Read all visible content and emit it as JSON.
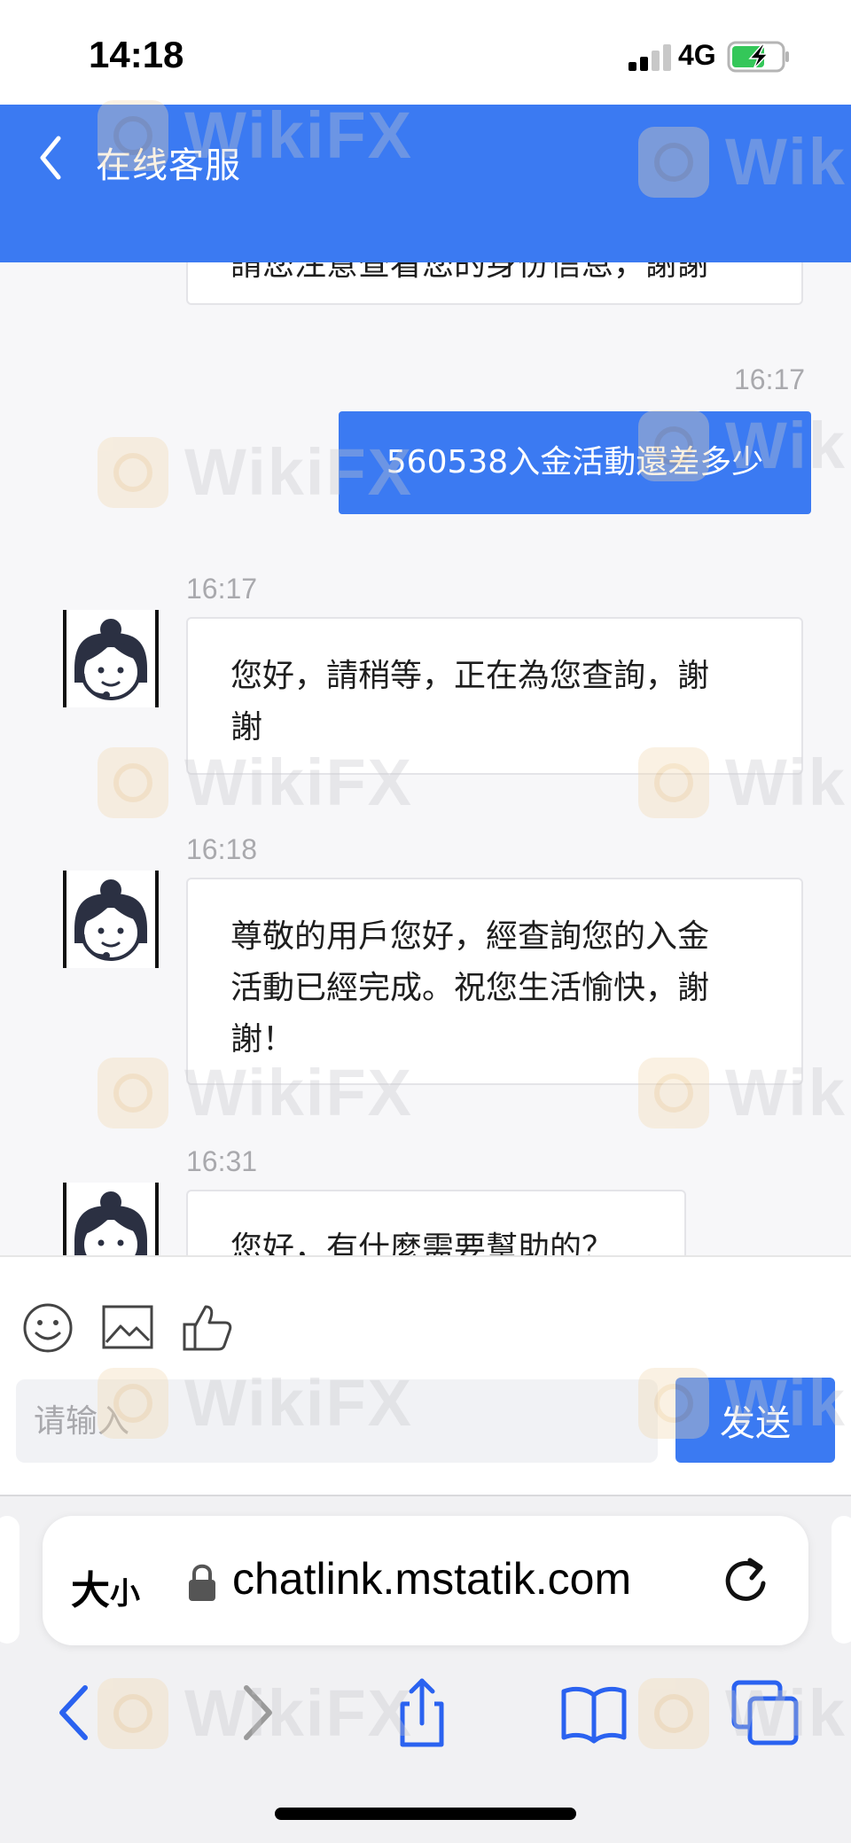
{
  "status_bar": {
    "time": "14:18",
    "network": "4G",
    "battery": "charging"
  },
  "header": {
    "title": "在线客服",
    "background_color": "#3b7af2"
  },
  "chat": {
    "partial_top_message": "請您注意查看您的身份信息，謝謝",
    "user_message": {
      "time": "16:17",
      "text": "560538入金活動還差多少"
    },
    "agent_messages": [
      {
        "time": "16:17",
        "lines": [
          "您好，請稍等，正在為您查詢，謝",
          "謝"
        ]
      },
      {
        "time": "16:18",
        "lines": [
          "尊敬的用戶您好，經查詢您的入金",
          "活動已經完成。祝您生活愉快，謝",
          "謝！"
        ]
      },
      {
        "time": "16:31",
        "lines": [
          "您好，有什麼需要幫助的？"
        ]
      }
    ]
  },
  "input": {
    "placeholder": "请输入",
    "send_label": "发送",
    "tools": [
      "emoji-icon",
      "image-icon",
      "thumbs-up-icon"
    ]
  },
  "browser": {
    "text_size_large": "大",
    "text_size_small": "小",
    "url": "chatlink.mstatik.com",
    "icons": [
      "lock-icon",
      "reload-icon",
      "back-icon",
      "forward-icon",
      "share-icon",
      "bookmarks-icon",
      "tabs-icon"
    ]
  },
  "watermark": {
    "text": "WikiFX"
  }
}
